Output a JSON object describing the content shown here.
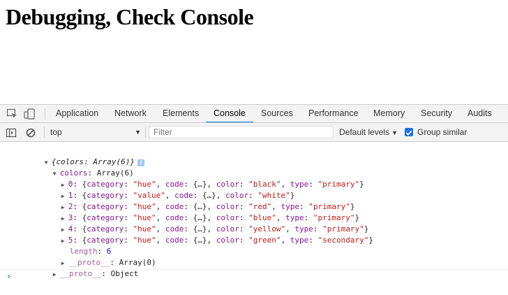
{
  "page": {
    "heading": "Debugging, Check Console"
  },
  "devtools": {
    "tabs": [
      "Application",
      "Network",
      "Elements",
      "Console",
      "Sources",
      "Performance",
      "Memory",
      "Security",
      "Audits"
    ],
    "active_tab": "Console",
    "context": "top",
    "filter_placeholder": "Filter",
    "levels_label": "Default levels",
    "group_similar_label": "Group similar",
    "group_similar_checked": true,
    "accent_color": "#1a73e8"
  },
  "console": {
    "root_summary": "{colors: Array(6)}",
    "colors_key": "colors",
    "colors_summary": "Array(6)",
    "items": [
      {
        "index": "0",
        "category": "\"hue\"",
        "color": "\"black\"",
        "type": "\"primary\""
      },
      {
        "index": "1",
        "category": "\"value\"",
        "color": "\"white\"",
        "type": null
      },
      {
        "index": "2",
        "category": "\"hue\"",
        "color": "\"red\"",
        "type": "\"primary\""
      },
      {
        "index": "3",
        "category": "\"hue\"",
        "color": "\"blue\"",
        "type": "\"primary\""
      },
      {
        "index": "4",
        "category": "\"hue\"",
        "color": "\"yellow\"",
        "type": "\"primary\""
      },
      {
        "index": "5",
        "category": "\"hue\"",
        "color": "\"green\"",
        "type": "\"secondary\""
      }
    ],
    "length_key": "length",
    "length_value": "6",
    "array_proto_key": "__proto__",
    "array_proto_value": "Array(0)",
    "object_proto_key": "__proto__",
    "object_proto_value": "Object",
    "code_placeholder": "{…}",
    "info_badge": "i"
  }
}
